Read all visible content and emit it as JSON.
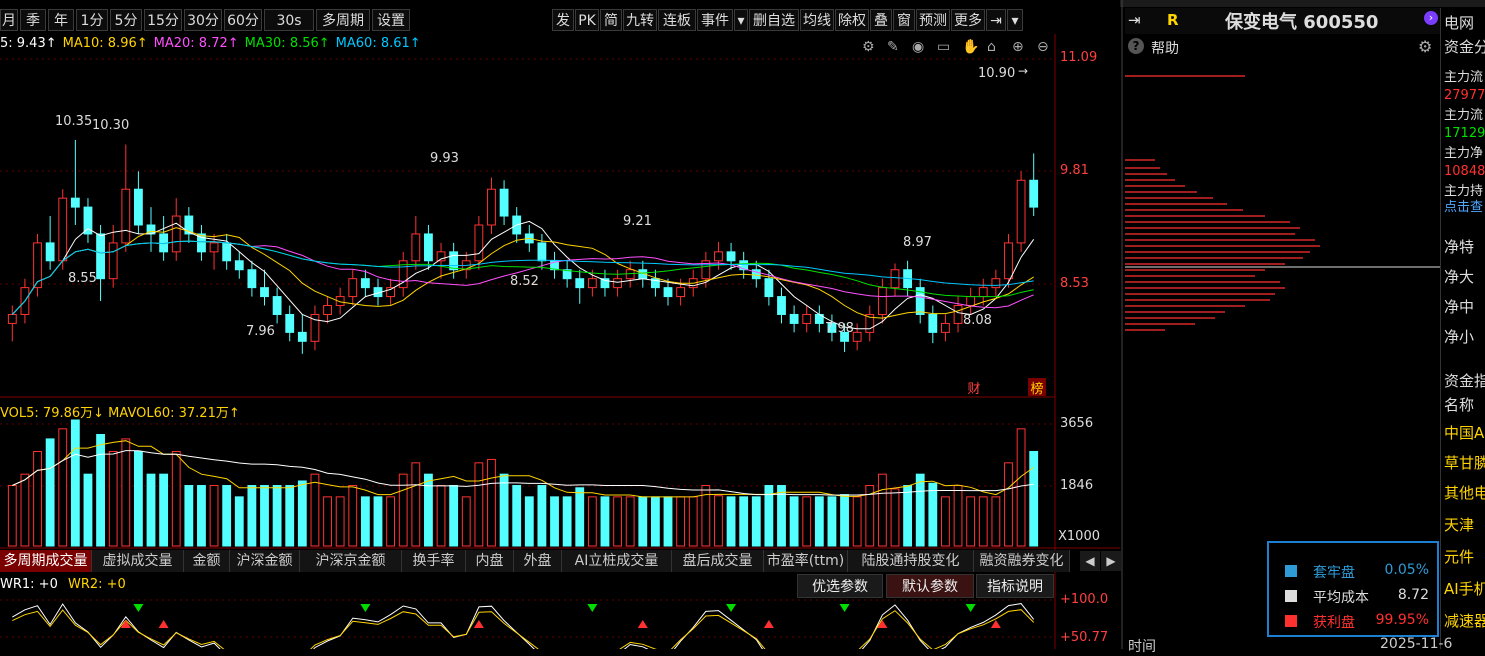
{
  "toolbar": {
    "left": [
      "月",
      "季",
      "年",
      "1分",
      "5分",
      "15分",
      "30分",
      "60分",
      "30s",
      "多周期",
      "设置"
    ],
    "right": [
      "发",
      "PK",
      "简",
      "九转",
      "连板",
      "事件",
      "▾",
      "删自选",
      "均线",
      "除权",
      "叠",
      "窗",
      "预测",
      "更多",
      "⇥",
      "▾"
    ]
  },
  "ma_legend": [
    {
      "label": "5: 9.43↑",
      "color": "#ffffff"
    },
    {
      "label": "MA10: 8.96↑",
      "color": "#ffd400"
    },
    {
      "label": "MA20: 8.72↑",
      "color": "#ff50ff"
    },
    {
      "label": "MA30: 8.56↑",
      "color": "#00e000"
    },
    {
      "label": "MA60: 8.61↑",
      "color": "#00c8ff"
    }
  ],
  "price_axis": {
    "top": "11.09",
    "mid": "9.81",
    "low": "8.53",
    "latest": "10.90"
  },
  "price_annotations": {
    "a": "10.35",
    "b": "10.30",
    "c": "8.55",
    "d": "7.96",
    "e": "9.93",
    "f": "8.52",
    "g": "9.21",
    "h": "8.97",
    "i": "7.98",
    "j": "8.08"
  },
  "badges": {
    "cai": "财",
    "bang": "榜"
  },
  "vol_legend": {
    "label": "VOL5: 79.86万↓  MAVOL60: 37.21万↑",
    "color": "#ffd400"
  },
  "vol_axis": {
    "top": "3656",
    "mid": "1846",
    "unit": "X1000"
  },
  "tabs": [
    "多周期成交量",
    "虚拟成交量",
    "金额",
    "沪深金额",
    "沪深京金额",
    "换手率",
    "内盘",
    "外盘",
    "AI立桩成交量",
    "盘后成交量",
    "市盈率(ttm)",
    "陆股通持股变化",
    "融资融券变化"
  ],
  "wr_legend": {
    "wr1": "WR1: +0",
    "wr2": "WR2: +0"
  },
  "param_buttons": [
    "优选参数",
    "默认参数",
    "指标说明"
  ],
  "wr_axis": {
    "top": "+100.0",
    "mid": "+50.77"
  },
  "right_panel": {
    "r": "R",
    "stock": "保变电气 600550",
    "help": "帮助"
  },
  "far_right": {
    "items": [
      "电网",
      "资金分",
      "主力流",
      "27977",
      "主力流",
      "17129",
      "主力净",
      "10848",
      "主力持",
      "点击查",
      "净特",
      "净大",
      "净中",
      "净小",
      "资金指",
      "名称",
      "中国A",
      "草甘膦",
      "其他电",
      "天津",
      "元件",
      "AI手机",
      "减速器"
    ]
  },
  "chip_legend": [
    {
      "label": "套牢盘",
      "value": "0.05%",
      "color": "#2e9bd6",
      "text": "#2e9bd6"
    },
    {
      "label": "平均成本",
      "value": "8.72",
      "color": "#dddddd",
      "text": "#dddddd"
    },
    {
      "label": "获利盘",
      "value": "99.95%",
      "color": "#ff3030",
      "text": "#ff3030"
    }
  ],
  "footer": {
    "time": "时间",
    "date": "2025-11-6"
  },
  "chart_data": {
    "type": "candlestick",
    "ohlc": [
      [
        8.3,
        8.5,
        8.1,
        8.4
      ],
      [
        8.4,
        8.8,
        8.3,
        8.7
      ],
      [
        8.7,
        9.3,
        8.6,
        9.2
      ],
      [
        9.2,
        9.5,
        8.9,
        9.0
      ],
      [
        9.0,
        9.8,
        8.9,
        9.7
      ],
      [
        9.7,
        10.35,
        9.4,
        9.6
      ],
      [
        9.6,
        9.7,
        9.2,
        9.3
      ],
      [
        9.3,
        9.4,
        8.55,
        8.8
      ],
      [
        8.8,
        9.4,
        8.7,
        9.2
      ],
      [
        9.2,
        10.3,
        9.1,
        9.8
      ],
      [
        9.8,
        10.0,
        9.3,
        9.4
      ],
      [
        9.4,
        9.6,
        9.1,
        9.3
      ],
      [
        9.3,
        9.5,
        9.0,
        9.1
      ],
      [
        9.1,
        9.7,
        9.0,
        9.5
      ],
      [
        9.5,
        9.6,
        9.2,
        9.3
      ],
      [
        9.3,
        9.4,
        9.0,
        9.1
      ],
      [
        9.1,
        9.3,
        8.9,
        9.2
      ],
      [
        9.2,
        9.3,
        8.9,
        9.0
      ],
      [
        9.0,
        9.1,
        8.8,
        8.9
      ],
      [
        8.9,
        9.0,
        8.6,
        8.7
      ],
      [
        8.7,
        8.9,
        8.5,
        8.6
      ],
      [
        8.6,
        8.7,
        8.3,
        8.4
      ],
      [
        8.4,
        8.5,
        8.1,
        8.2
      ],
      [
        8.2,
        8.4,
        7.96,
        8.1
      ],
      [
        8.1,
        8.5,
        8.0,
        8.4
      ],
      [
        8.4,
        8.6,
        8.3,
        8.5
      ],
      [
        8.5,
        8.7,
        8.4,
        8.6
      ],
      [
        8.6,
        8.9,
        8.5,
        8.8
      ],
      [
        8.8,
        8.9,
        8.6,
        8.7
      ],
      [
        8.7,
        8.8,
        8.5,
        8.6
      ],
      [
        8.6,
        8.8,
        8.5,
        8.7
      ],
      [
        8.7,
        9.1,
        8.6,
        9.0
      ],
      [
        9.0,
        9.5,
        8.9,
        9.3
      ],
      [
        9.3,
        9.4,
        8.9,
        9.0
      ],
      [
        9.0,
        9.2,
        8.8,
        9.1
      ],
      [
        9.1,
        9.2,
        8.8,
        8.9
      ],
      [
        8.9,
        9.1,
        8.8,
        9.0
      ],
      [
        9.0,
        9.5,
        8.9,
        9.4
      ],
      [
        9.4,
        9.93,
        9.3,
        9.8
      ],
      [
        9.8,
        9.9,
        9.4,
        9.5
      ],
      [
        9.5,
        9.6,
        9.2,
        9.3
      ],
      [
        9.3,
        9.4,
        9.1,
        9.2
      ],
      [
        9.2,
        9.3,
        8.9,
        9.0
      ],
      [
        9.0,
        9.1,
        8.8,
        8.9
      ],
      [
        8.9,
        9.0,
        8.7,
        8.8
      ],
      [
        8.8,
        8.9,
        8.52,
        8.7
      ],
      [
        8.7,
        8.9,
        8.6,
        8.8
      ],
      [
        8.8,
        8.9,
        8.6,
        8.7
      ],
      [
        8.7,
        8.9,
        8.6,
        8.8
      ],
      [
        8.8,
        9.0,
        8.7,
        8.9
      ],
      [
        8.9,
        9.0,
        8.7,
        8.8
      ],
      [
        8.8,
        8.9,
        8.6,
        8.7
      ],
      [
        8.7,
        8.8,
        8.5,
        8.6
      ],
      [
        8.6,
        8.8,
        8.5,
        8.7
      ],
      [
        8.7,
        8.9,
        8.6,
        8.8
      ],
      [
        8.8,
        9.1,
        8.7,
        9.0
      ],
      [
        9.0,
        9.21,
        8.9,
        9.1
      ],
      [
        9.1,
        9.2,
        8.9,
        9.0
      ],
      [
        9.0,
        9.1,
        8.8,
        8.9
      ],
      [
        8.9,
        9.0,
        8.7,
        8.8
      ],
      [
        8.8,
        8.9,
        8.5,
        8.6
      ],
      [
        8.6,
        8.7,
        8.3,
        8.4
      ],
      [
        8.4,
        8.5,
        8.2,
        8.3
      ],
      [
        8.3,
        8.5,
        8.2,
        8.4
      ],
      [
        8.4,
        8.5,
        8.2,
        8.3
      ],
      [
        8.3,
        8.4,
        8.1,
        8.2
      ],
      [
        8.2,
        8.3,
        7.98,
        8.1
      ],
      [
        8.1,
        8.3,
        8.0,
        8.2
      ],
      [
        8.2,
        8.5,
        8.1,
        8.4
      ],
      [
        8.4,
        8.8,
        8.3,
        8.7
      ],
      [
        8.7,
        8.97,
        8.6,
        8.9
      ],
      [
        8.9,
        9.0,
        8.6,
        8.7
      ],
      [
        8.7,
        8.8,
        8.3,
        8.4
      ],
      [
        8.4,
        8.5,
        8.08,
        8.2
      ],
      [
        8.2,
        8.4,
        8.1,
        8.3
      ],
      [
        8.3,
        8.6,
        8.2,
        8.5
      ],
      [
        8.5,
        8.7,
        8.4,
        8.6
      ],
      [
        8.6,
        8.8,
        8.5,
        8.7
      ],
      [
        8.7,
        8.9,
        8.6,
        8.8
      ],
      [
        8.8,
        9.3,
        8.7,
        9.2
      ],
      [
        9.2,
        10.0,
        9.1,
        9.9
      ],
      [
        9.9,
        10.2,
        9.5,
        9.6
      ]
    ],
    "ylim": [
      7.5,
      11.3
    ]
  }
}
